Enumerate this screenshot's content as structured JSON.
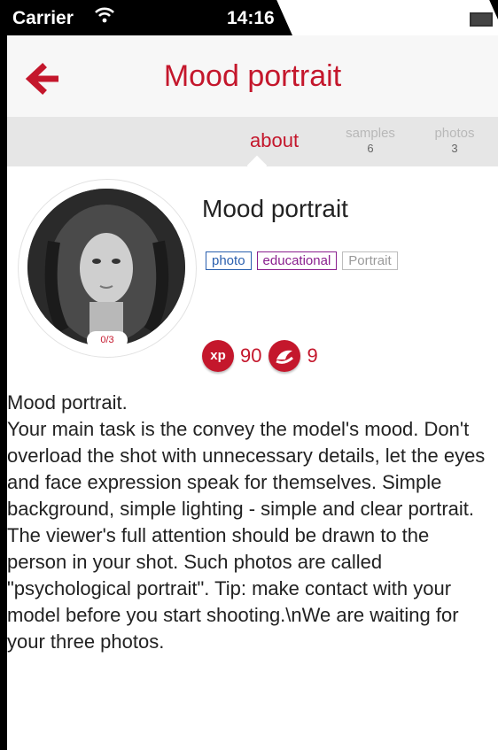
{
  "status_bar": {
    "carrier": "Carrier",
    "time": "14:16"
  },
  "nav": {
    "title": "Mood portrait"
  },
  "tabs": [
    {
      "label": "about"
    },
    {
      "label": "samples",
      "count": "6"
    },
    {
      "label": "photos",
      "count": "3"
    }
  ],
  "profile": {
    "heading": "Mood portrait",
    "progress": "0/3",
    "tags": [
      "photo",
      "educational",
      "Portrait"
    ],
    "xp_icon": "xp",
    "xp": "90",
    "level": "9"
  },
  "description": {
    "title": "Mood portrait.",
    "body": "Your main task is the convey the model's mood. Don't overload the shot with unnecessary details, let the eyes and face expression speak for themselves. Simple background, simple lighting - simple and clear portrait. The viewer's full attention should be drawn to the person in your shot. Such photos are called \"psychological portrait\". Tip: make contact with your model before you start shooting.\\nWe are waiting for your three photos."
  },
  "icons": {
    "back": "back-arrow-icon",
    "wifi": "wifi-icon",
    "battery": "battery-icon",
    "level": "level-badge-icon"
  },
  "colors": {
    "accent": "#c4172c",
    "tag_blue": "#2a5fae",
    "tag_purple": "#8a1f8e"
  }
}
